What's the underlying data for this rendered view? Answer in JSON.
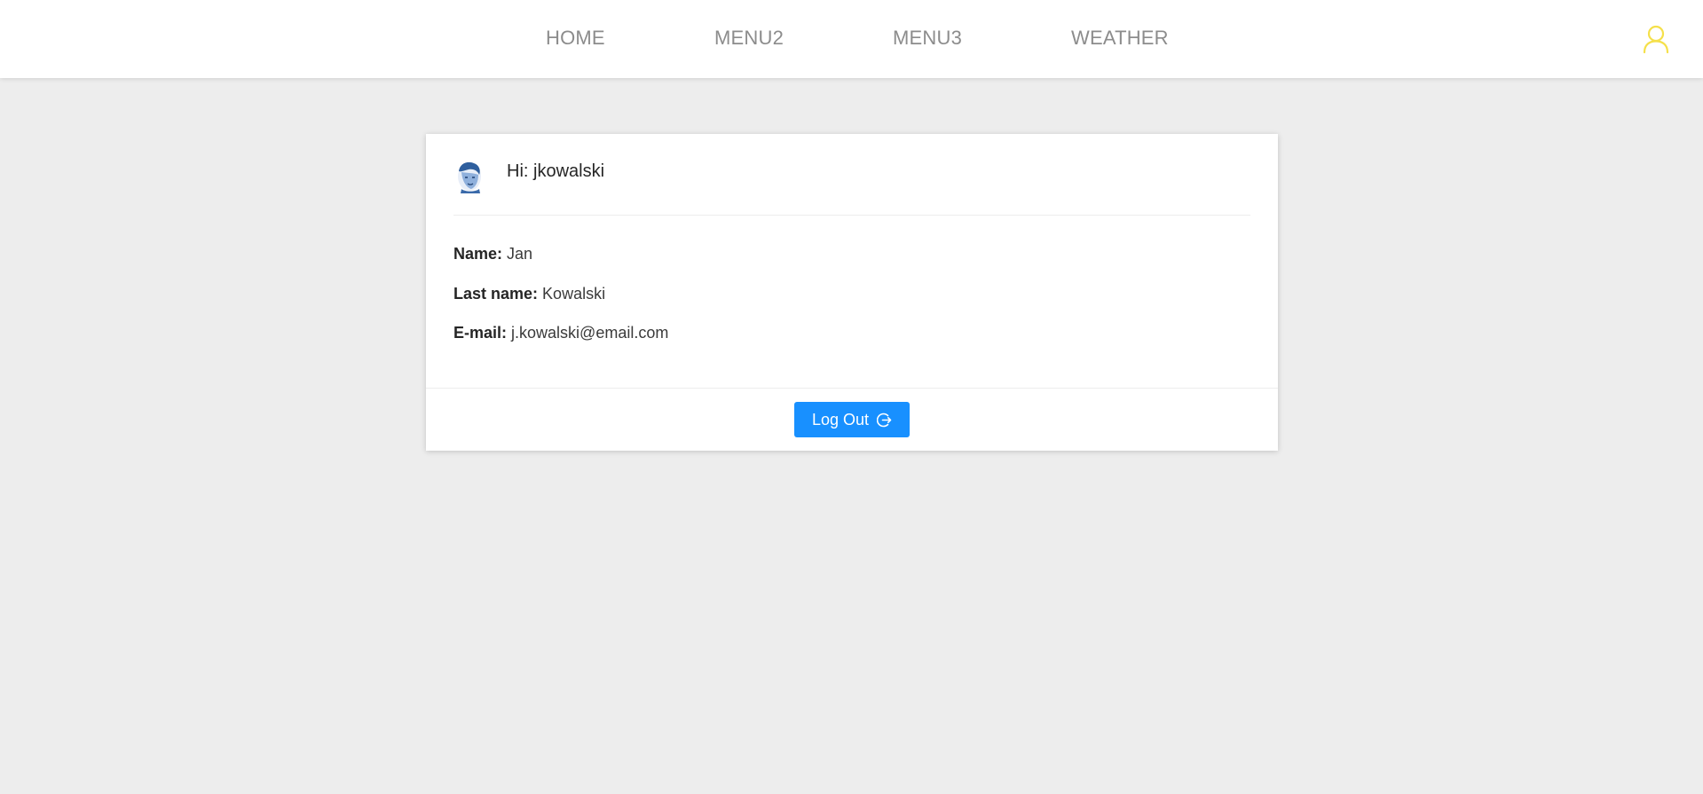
{
  "nav": {
    "items": [
      {
        "label": "HOME"
      },
      {
        "label": "MENU2"
      },
      {
        "label": "MENU3"
      },
      {
        "label": "WEATHER"
      }
    ],
    "user_icon": "user-icon",
    "user_icon_color": "#f5e04a"
  },
  "profile": {
    "greeting": "Hi: jkowalski",
    "avatar_icon": "avatar-portrait",
    "fields": [
      {
        "label": "Name:",
        "value": "Jan"
      },
      {
        "label": "Last name:",
        "value": "Kowalski"
      },
      {
        "label": "E-mail:",
        "value": "j.kowalski@email.com"
      }
    ]
  },
  "actions": {
    "logout_label": "Log Out",
    "logout_icon": "logout-icon",
    "button_color": "#1890ff"
  }
}
